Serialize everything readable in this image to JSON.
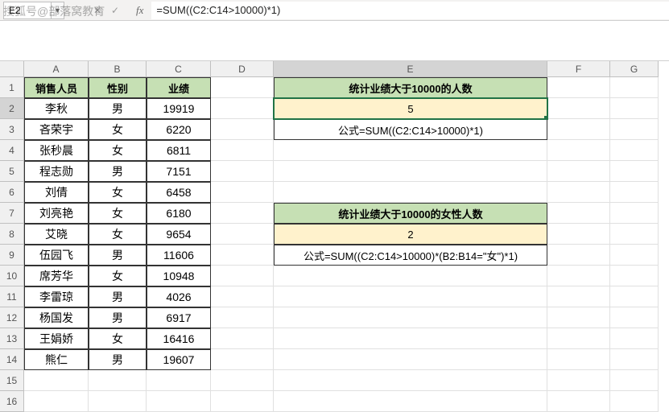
{
  "watermark": "搜狐号@部落窝教育",
  "nameBox": "E2",
  "formulaBar": "=SUM((C2:C14>10000)*1)",
  "columns": [
    "A",
    "B",
    "C",
    "D",
    "E",
    "F",
    "G"
  ],
  "rowNums": [
    "1",
    "2",
    "3",
    "4",
    "5",
    "6",
    "7",
    "8",
    "9",
    "10",
    "11",
    "12",
    "13",
    "14",
    "15",
    "16"
  ],
  "headers": {
    "A": "销售人员",
    "B": "性别",
    "C": "业绩"
  },
  "data": [
    {
      "name": "李秋",
      "gender": "男",
      "perf": "19919"
    },
    {
      "name": "吝荣宇",
      "gender": "女",
      "perf": "6220"
    },
    {
      "name": "张秒晨",
      "gender": "女",
      "perf": "6811"
    },
    {
      "name": "程志勋",
      "gender": "男",
      "perf": "7151"
    },
    {
      "name": "刘倩",
      "gender": "女",
      "perf": "6458"
    },
    {
      "name": "刘亮艳",
      "gender": "女",
      "perf": "6180"
    },
    {
      "name": "艾晓",
      "gender": "女",
      "perf": "9654"
    },
    {
      "name": "伍园飞",
      "gender": "男",
      "perf": "11606"
    },
    {
      "name": "席芳华",
      "gender": "女",
      "perf": "10948"
    },
    {
      "name": "李雷琼",
      "gender": "男",
      "perf": "4026"
    },
    {
      "name": "杨国发",
      "gender": "男",
      "perf": "6917"
    },
    {
      "name": "王娟娇",
      "gender": "女",
      "perf": "16416"
    },
    {
      "name": "熊仁",
      "gender": "男",
      "perf": "19607"
    }
  ],
  "box1": {
    "title": "统计业绩大于10000的人数",
    "value": "5",
    "formula": "公式=SUM((C2:C14>10000)*1)"
  },
  "box2": {
    "title": "统计业绩大于10000的女性人数",
    "value": "2",
    "formula": "公式=SUM((C2:C14>10000)*(B2:B14=\"女\")*1)"
  }
}
